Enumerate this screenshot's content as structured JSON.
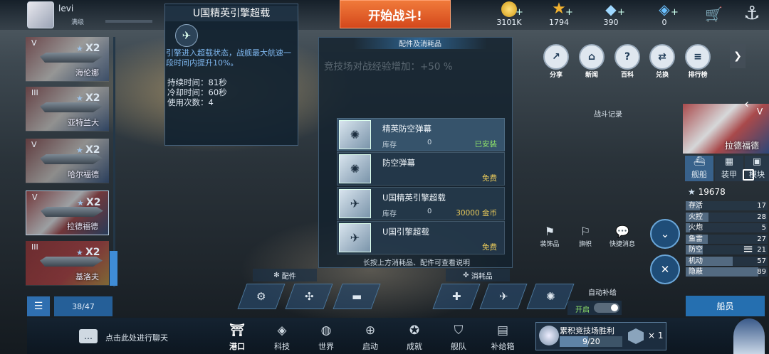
{
  "topbar": {
    "username": "levi",
    "level_label": "满级",
    "start_battle": "开始战斗!",
    "resources": [
      {
        "name": "gold-coin-icon",
        "value": "3101K",
        "color": "#f0c030"
      },
      {
        "name": "star-icon",
        "value": "1794",
        "color": "#f2b230"
      },
      {
        "name": "diamond-icon",
        "value": "390",
        "color": "#9fd8ff"
      },
      {
        "name": "crystal-icon",
        "value": "0",
        "color": "#6ac0ff"
      }
    ],
    "plus": "+"
  },
  "tooltip": {
    "title": "U国精英引擎超载",
    "description": "引擎进入超载状态，战舰最大航速一段时间内提升10%。",
    "duration": "持续时间：81秒",
    "cooldown": "冷却时间：60秒",
    "uses": "使用次数：4"
  },
  "panel": {
    "title": "配件及消耗品",
    "bonus": "竞技场对战经验增加：+50 %",
    "hint": "长按上方消耗品、配件可查看说明",
    "items": [
      {
        "name": "精英防空弹幕",
        "stock_label": "库存",
        "qty": "0",
        "value": "已安装",
        "status": "installed"
      },
      {
        "name": "防空弹幕",
        "stock_label": "",
        "qty": "",
        "value": "免费",
        "status": "free"
      },
      {
        "name": "U国精英引擎超载",
        "stock_label": "库存",
        "qty": "0",
        "value": "30000 金币",
        "status": "price"
      },
      {
        "name": "U国引擎超载",
        "stock_label": "",
        "qty": "",
        "value": "免费",
        "status": "free"
      }
    ]
  },
  "ships": [
    {
      "tier": "V",
      "name": "海伦娜",
      "multiplier": "X2"
    },
    {
      "tier": "III",
      "name": "亚特兰大",
      "multiplier": "X2"
    },
    {
      "tier": "V",
      "name": "哈尔福德",
      "multiplier": "X2"
    },
    {
      "tier": "V",
      "name": "拉德福德",
      "multiplier": "X2"
    },
    {
      "tier": "III",
      "name": "基洛夫",
      "multiplier": "X2"
    }
  ],
  "shiplist": {
    "count": "38/47"
  },
  "menu": [
    {
      "label": "分享",
      "icon": "share-icon"
    },
    {
      "label": "新闻",
      "icon": "news-icon"
    },
    {
      "label": "百科",
      "icon": "encyclopedia-icon"
    },
    {
      "label": "兑换",
      "icon": "exchange-icon"
    },
    {
      "label": "排行榜",
      "icon": "leaderboard-icon"
    }
  ],
  "battle_record": "战斗记录",
  "right_card": {
    "tier": "V",
    "ship_name": "拉德福德",
    "tabs": [
      "舰船",
      "装甲",
      "模块"
    ],
    "power": "19678",
    "stats": [
      {
        "label": "存活",
        "value": "17",
        "fill": 0.17
      },
      {
        "label": "火控",
        "value": "28",
        "fill": 0.28
      },
      {
        "label": "火炮",
        "value": "5",
        "fill": 0.05
      },
      {
        "label": "鱼雷",
        "value": "27",
        "fill": 0.27
      },
      {
        "label": "防空",
        "value": "21",
        "fill": 0.21
      },
      {
        "label": "机动",
        "value": "57",
        "fill": 0.57
      },
      {
        "label": "隐蔽",
        "value": "89",
        "fill": 0.89
      }
    ],
    "crew_button": "船员"
  },
  "deco": [
    {
      "label": "装饰品",
      "icon": "ornament-icon"
    },
    {
      "label": "旗帜",
      "icon": "flag-icon"
    },
    {
      "label": "快捷消息",
      "icon": "chat-bubble-icon"
    }
  ],
  "slots": {
    "equip_label": "配件",
    "consumable_label": "消耗品",
    "auto_label": "自动补给",
    "auto_state": "开启"
  },
  "chat_hint": "点击此处进行聊天",
  "nav": [
    {
      "label": "港口",
      "icon": "port-icon"
    },
    {
      "label": "科技",
      "icon": "tech-icon"
    },
    {
      "label": "世界",
      "icon": "globe-icon"
    },
    {
      "label": "启动",
      "icon": "launch-icon"
    },
    {
      "label": "成就",
      "icon": "achievement-icon"
    },
    {
      "label": "舰队",
      "icon": "fleet-icon"
    },
    {
      "label": "补给箱",
      "icon": "supply-box-icon"
    }
  ],
  "quest": {
    "title": "累积竞技场胜利",
    "progress": "9/20",
    "progress_fraction": 0.45,
    "reward": "× 1"
  }
}
